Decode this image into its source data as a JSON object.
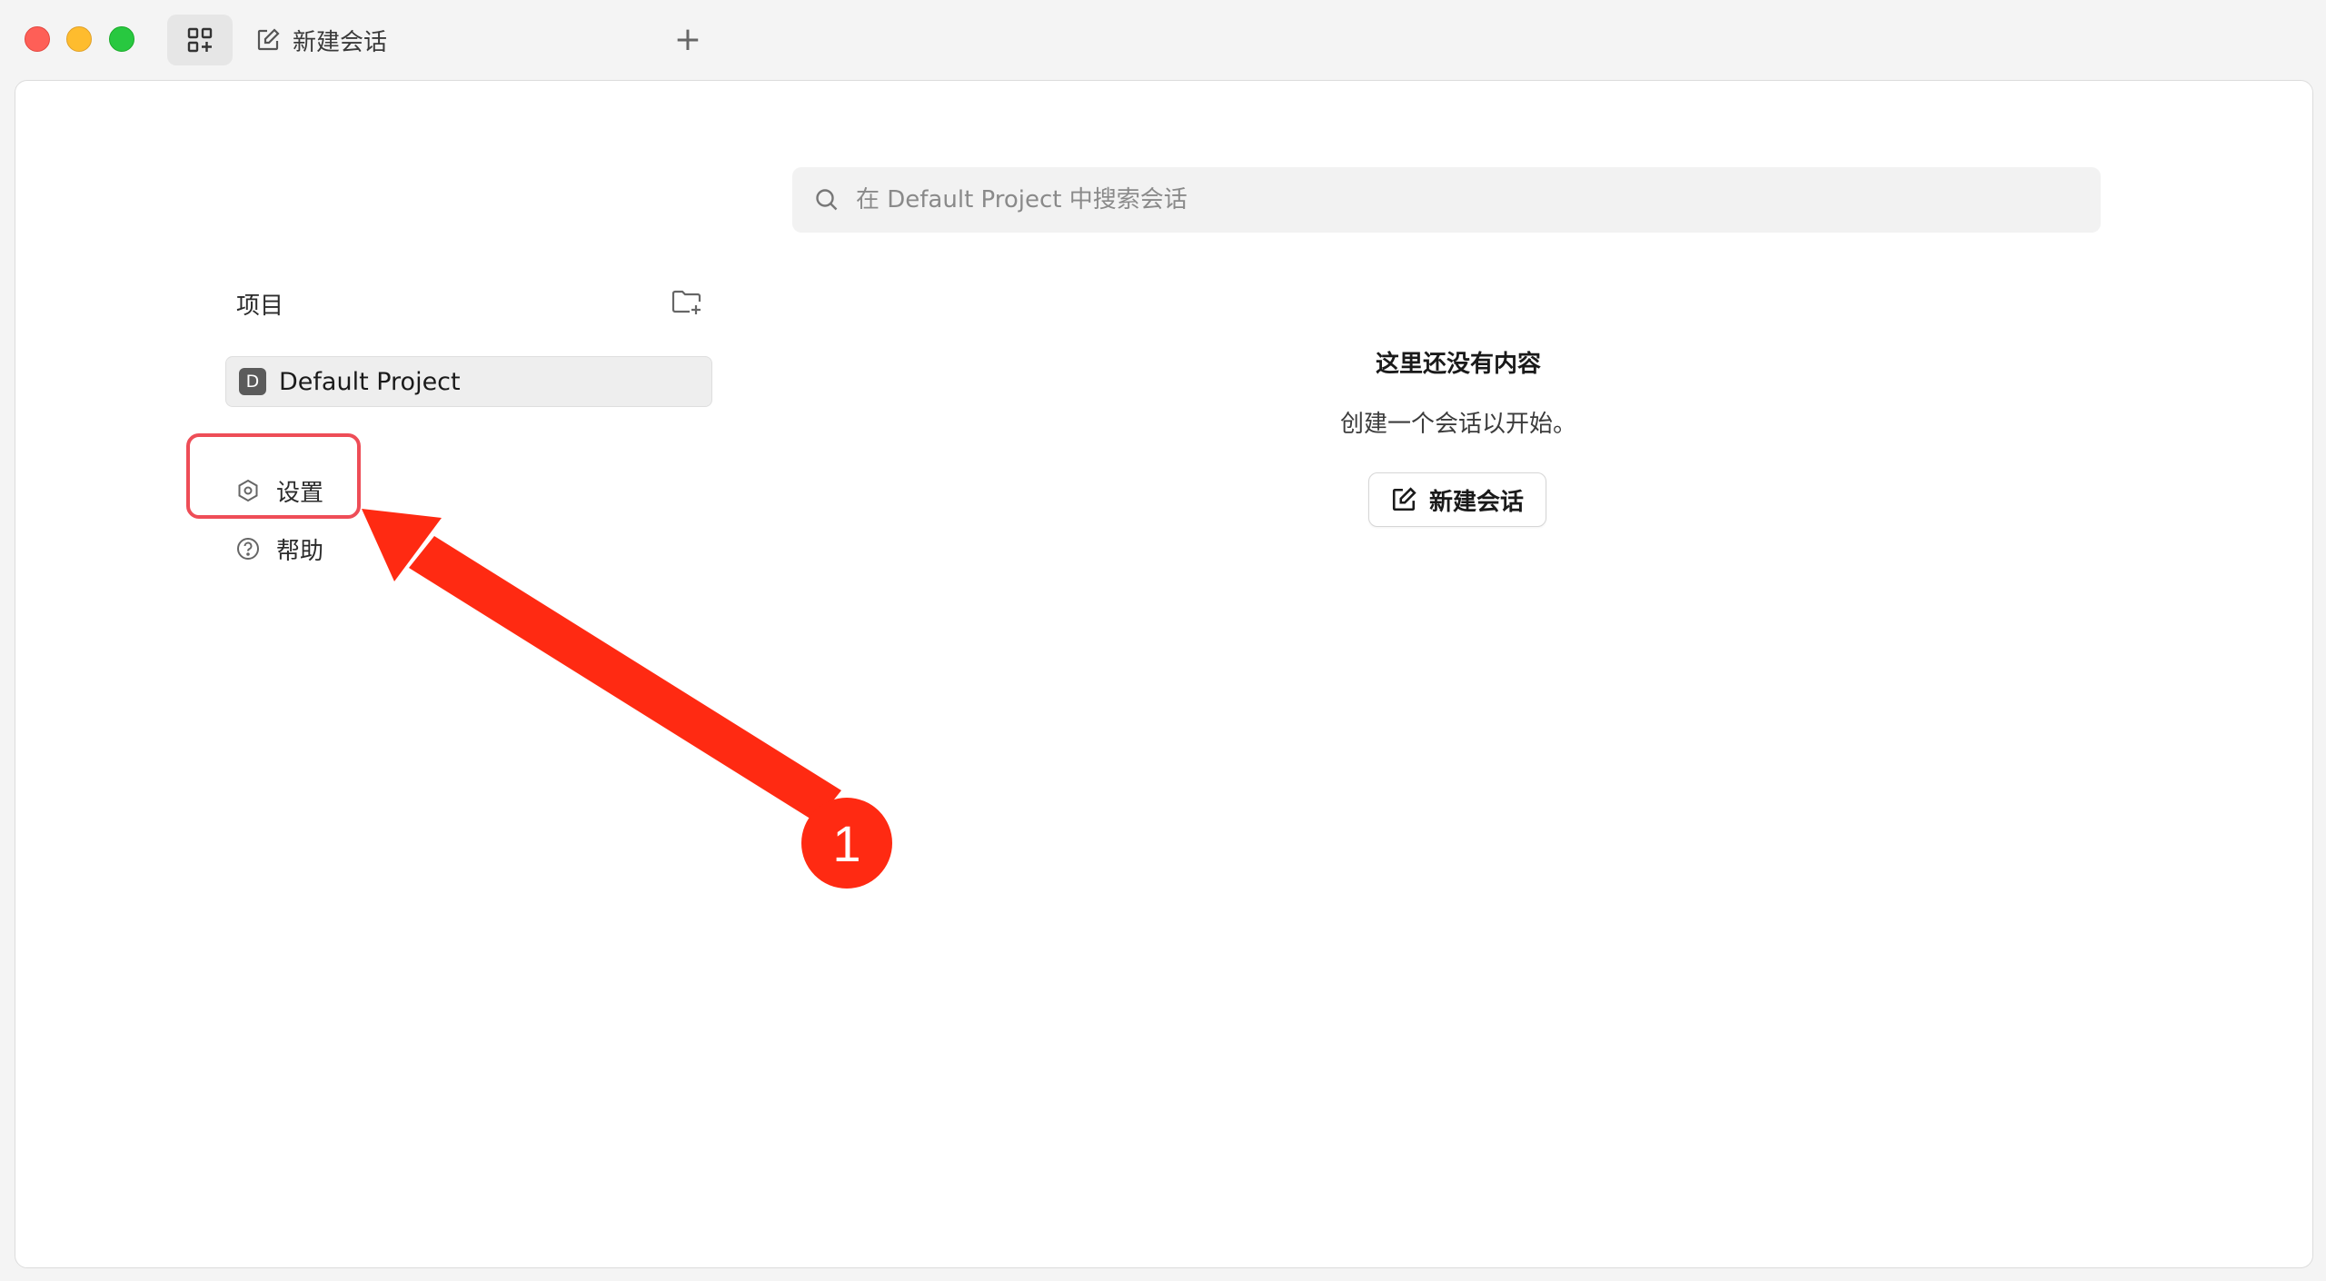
{
  "titlebar": {
    "tab_label": "新建会话",
    "tab_icon": "edit-icon",
    "add_tab_symbol": "+"
  },
  "search": {
    "placeholder": "在 Default Project 中搜索会话"
  },
  "sidebar": {
    "projects_label": "项目",
    "projects": [
      {
        "initial": "D",
        "name": "Default Project"
      }
    ],
    "menu": [
      {
        "label": "设置",
        "icon": "settings-icon"
      },
      {
        "label": "帮助",
        "icon": "help-icon"
      }
    ]
  },
  "empty_state": {
    "title": "这里还没有内容",
    "subtitle": "创建一个会话以开始。",
    "button_label": "新建会话"
  },
  "annotation": {
    "step_number": "1",
    "color": "#ff2a12",
    "box_color": "#ee4d57"
  }
}
